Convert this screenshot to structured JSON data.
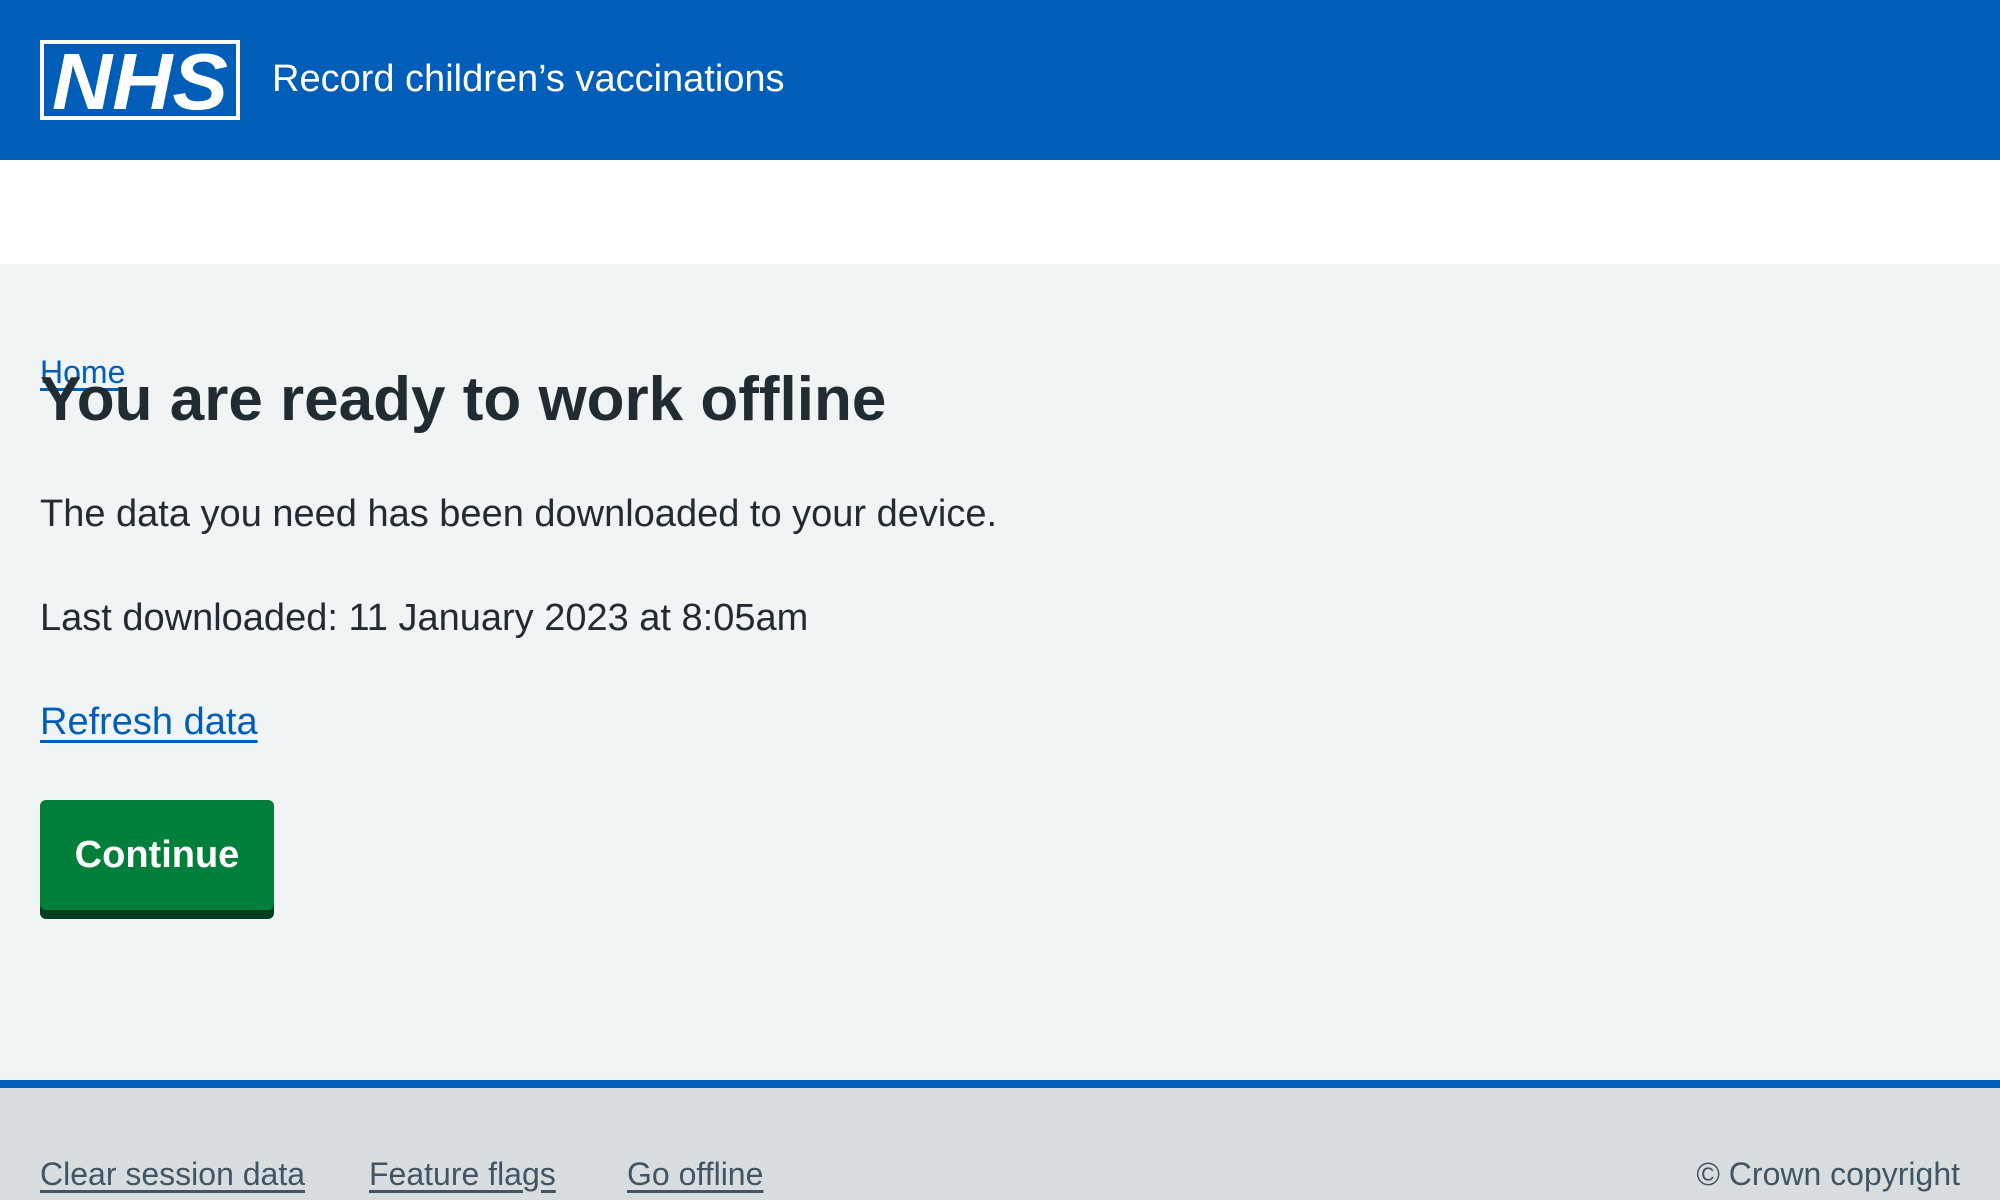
{
  "header": {
    "logo_text": "NHS",
    "service_name": "Record children’s vaccinations",
    "background_color": "#005eb8"
  },
  "breadcrumb": {
    "home_label": "Home"
  },
  "main": {
    "title": "You are ready to work offline",
    "description": "The data you need has been downloaded to your device.",
    "last_downloaded": "Last downloaded: 11 January 2023 at 8:05am",
    "refresh_link": "Refresh data",
    "continue_label": "Continue",
    "button_color": "#007f3b"
  },
  "footer": {
    "links": [
      "Clear session data",
      "Feature flags",
      "Go offline"
    ],
    "copyright": "© Crown copyright"
  }
}
